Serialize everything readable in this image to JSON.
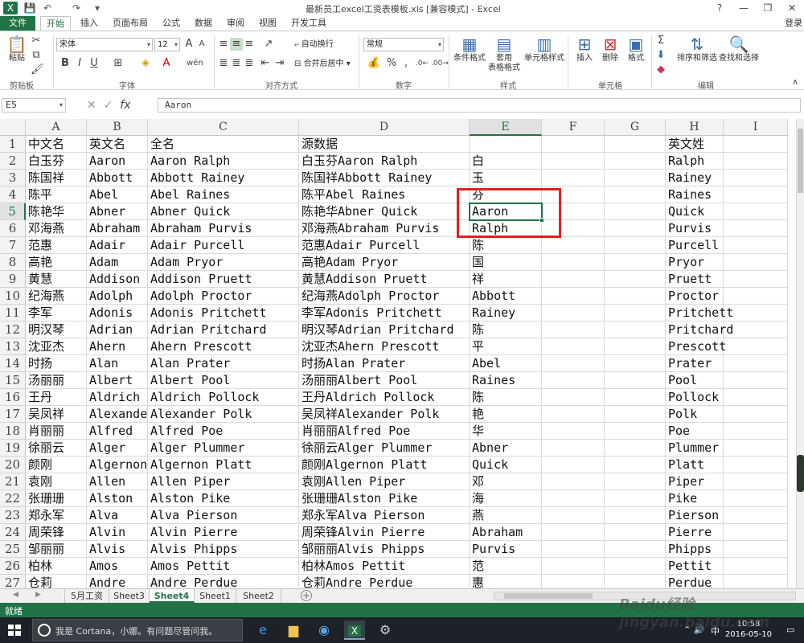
{
  "window": {
    "title": "最新员工excel工资表模板.xls  [兼容模式] - Excel",
    "minimize": "—",
    "restore": "❐",
    "close": "✕",
    "help": "?"
  },
  "quick_access": [
    "💾",
    "↶",
    "↷",
    "▾"
  ],
  "ribbon_tabs": [
    "文件",
    "开始",
    "插入",
    "页面布局",
    "公式",
    "数据",
    "审阅",
    "视图",
    "开发工具"
  ],
  "login": "登录",
  "ribbon": {
    "clipboard": {
      "label": "剪贴板",
      "paste": "粘贴"
    },
    "font": {
      "label": "字体",
      "name": "宋体",
      "size": "12"
    },
    "alignment": {
      "label": "对齐方式",
      "wrap": "自动换行",
      "merge": "合并后居中"
    },
    "number": {
      "label": "数字",
      "format": "常规",
      "percent": "%"
    },
    "styles": {
      "label": "样式",
      "cond": "条件格式",
      "table": "套用\n表格格式",
      "cell": "单元格样式"
    },
    "cells": {
      "label": "单元格",
      "insert": "插入",
      "delete": "删除",
      "format": "格式"
    },
    "editing": {
      "label": "编辑",
      "sort": "排序和筛选",
      "find": "查找和选择"
    }
  },
  "formula_bar": {
    "name_box": "E5",
    "content": "Aaron",
    "fx": "fx"
  },
  "columns": [
    "A",
    "B",
    "C",
    "D",
    "E",
    "F",
    "G",
    "H",
    "I"
  ],
  "selected_column": "E",
  "selected_row": "5",
  "rows": [
    [
      "1",
      "中文名",
      "英文名",
      "全名",
      "源数据",
      "",
      "",
      "",
      "英文姓",
      ""
    ],
    [
      "2",
      "白玉芬",
      "Aaron",
      "Aaron Ralph",
      "白玉芬Aaron Ralph",
      "白",
      "",
      "",
      "Ralph",
      ""
    ],
    [
      "3",
      "陈国祥",
      "Abbott",
      "Abbott Rainey",
      "陈国祥Abbott Rainey",
      "玉",
      "",
      "",
      "Rainey",
      ""
    ],
    [
      "4",
      "陈平",
      "Abel",
      "Abel Raines",
      "陈平Abel Raines",
      "芬",
      "",
      "",
      "Raines",
      ""
    ],
    [
      "5",
      "陈艳华",
      "Abner",
      "Abner Quick",
      "陈艳华Abner Quick",
      "Aaron",
      "",
      "",
      "Quick",
      ""
    ],
    [
      "6",
      "邓海燕",
      "Abraham",
      "Abraham Purvis",
      "邓海燕Abraham Purvis",
      "Ralph",
      "",
      "",
      "Purvis",
      ""
    ],
    [
      "7",
      "范惠",
      "Adair",
      "Adair Purcell",
      "范惠Adair Purcell",
      "陈",
      "",
      "",
      "Purcell",
      ""
    ],
    [
      "8",
      "高艳",
      "Adam",
      "Adam Pryor",
      "高艳Adam Pryor",
      "国",
      "",
      "",
      "Pryor",
      ""
    ],
    [
      "9",
      "黄慧",
      "Addison",
      "Addison Pruett",
      "黄慧Addison Pruett",
      "祥",
      "",
      "",
      "Pruett",
      ""
    ],
    [
      "10",
      "纪海燕",
      "Adolph",
      "Adolph Proctor",
      "纪海燕Adolph Proctor",
      "Abbott",
      "",
      "",
      "Proctor",
      ""
    ],
    [
      "11",
      "李军",
      "Adonis",
      "Adonis Pritchett",
      "李军Adonis Pritchett",
      "Rainey",
      "",
      "",
      "Pritchett",
      ""
    ],
    [
      "12",
      "明汉琴",
      "Adrian",
      "Adrian Pritchard",
      "明汉琴Adrian Pritchard",
      "陈",
      "",
      "",
      "Pritchard",
      ""
    ],
    [
      "13",
      "沈亚杰",
      "Ahern",
      "Ahern Prescott",
      "沈亚杰Ahern Prescott",
      "平",
      "",
      "",
      "Prescott",
      ""
    ],
    [
      "14",
      "时扬",
      "Alan",
      "Alan Prater",
      "时扬Alan Prater",
      "Abel",
      "",
      "",
      "Prater",
      ""
    ],
    [
      "15",
      "汤丽丽",
      "Albert",
      "Albert Pool",
      "汤丽丽Albert Pool",
      "Raines",
      "",
      "",
      "Pool",
      ""
    ],
    [
      "16",
      "王丹",
      "Aldrich",
      "Aldrich Pollock",
      "王丹Aldrich Pollock",
      "陈",
      "",
      "",
      "Pollock",
      ""
    ],
    [
      "17",
      "吴凤祥",
      "Alexander",
      "Alexander Polk",
      "吴凤祥Alexander Polk",
      "艳",
      "",
      "",
      "Polk",
      ""
    ],
    [
      "18",
      "肖丽丽",
      "Alfred",
      "Alfred Poe",
      "肖丽丽Alfred Poe",
      "华",
      "",
      "",
      "Poe",
      ""
    ],
    [
      "19",
      "徐丽云",
      "Alger",
      "Alger Plummer",
      "徐丽云Alger Plummer",
      "Abner",
      "",
      "",
      "Plummer",
      ""
    ],
    [
      "20",
      "颜刚",
      "Algernon",
      "Algernon Platt",
      "颜刚Algernon Platt",
      "Quick",
      "",
      "",
      "Platt",
      ""
    ],
    [
      "21",
      "袁刚",
      "Allen",
      "Allen Piper",
      "袁刚Allen Piper",
      "邓",
      "",
      "",
      "Piper",
      ""
    ],
    [
      "22",
      "张珊珊",
      "Alston",
      "Alston Pike",
      "张珊珊Alston Pike",
      "海",
      "",
      "",
      "Pike",
      ""
    ],
    [
      "23",
      "郑永军",
      "Alva",
      "Alva Pierson",
      "郑永军Alva Pierson",
      "燕",
      "",
      "",
      "Pierson",
      ""
    ],
    [
      "24",
      "周荣锋",
      "Alvin",
      "Alvin Pierre",
      "周荣锋Alvin Pierre",
      "Abraham",
      "",
      "",
      "Pierre",
      ""
    ],
    [
      "25",
      "邹丽丽",
      "Alvis",
      "Alvis Phipps",
      "邹丽丽Alvis Phipps",
      "Purvis",
      "",
      "",
      "Phipps",
      ""
    ],
    [
      "26",
      "柏林",
      "Amos",
      "Amos Pettit",
      "柏林Amos Pettit",
      "范",
      "",
      "",
      "Pettit",
      ""
    ],
    [
      "27",
      "仓莉",
      "Andre",
      "Andre Perdue",
      "仓莉Andre Perdue",
      "惠",
      "",
      "",
      "Perdue",
      ""
    ]
  ],
  "sheet_tabs": [
    "5月工资",
    "Sheet3",
    "Sheet4",
    "Sheet1",
    "Sheet2"
  ],
  "active_sheet": "Sheet4",
  "status": "就绪",
  "taskbar": {
    "cortana": "我是 Cortana，小娜。有问题尽管问我。",
    "ime": "中",
    "time": "10:58",
    "date": "2016-05-10"
  },
  "watermark": "Baidu经验 jingyan.baidu.com",
  "colors": {
    "excel_green": "#217346",
    "highlight_red": "#e02020"
  }
}
